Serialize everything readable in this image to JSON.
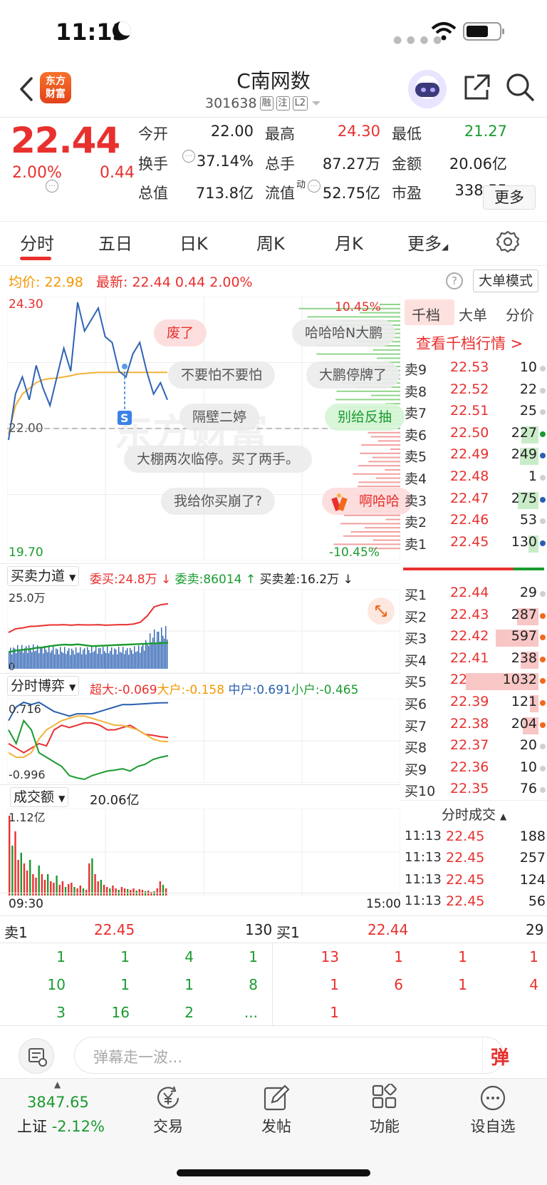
{
  "status": {
    "time": "11:13"
  },
  "header": {
    "logo_line1": "东方",
    "logo_line2": "财富",
    "name": "C南网数",
    "code": "301638",
    "tags": [
      "融",
      "注",
      "L2"
    ]
  },
  "quote": {
    "price": "22.44",
    "pct": "2.00%",
    "change": "0.44",
    "fields": [
      {
        "label": "今开",
        "value": "22.00",
        "color": "#222"
      },
      {
        "label": "最高",
        "value": "24.30",
        "color": "#e8302e"
      },
      {
        "label": "最低",
        "value": "21.27",
        "color": "#1a9b30"
      },
      {
        "label": "换手",
        "value": "37.14%",
        "color": "#222"
      },
      {
        "label": "总手",
        "value": "87.27万",
        "color": "#222"
      },
      {
        "label": "金额",
        "value": "20.06亿",
        "color": "#222"
      },
      {
        "label": "总值",
        "value": "713.8亿",
        "color": "#222"
      },
      {
        "label": "流值",
        "value": "52.75亿",
        "color": "#222"
      },
      {
        "label": "市盈",
        "value": "338.55",
        "color": "#222"
      }
    ],
    "pe_sup": "动",
    "more": "更多"
  },
  "tabs": [
    {
      "label": "分时",
      "active": true
    },
    {
      "label": "五日"
    },
    {
      "label": "日K"
    },
    {
      "label": "周K"
    },
    {
      "label": "月K"
    },
    {
      "label": "更多"
    }
  ],
  "avg_line": {
    "avg_label": "均价:",
    "avg_value": "22.98",
    "latest_label": "最新:",
    "latest_value": "22.44",
    "latest_chg": "0.44",
    "latest_pct": "2.00%",
    "mode_button": "大单模式"
  },
  "main_chart": {
    "y_top": "24.30",
    "y_mid": "22.00",
    "y_bottom": "19.70",
    "pct_top": "10.45%",
    "pct_bottom": "-10.45%",
    "marker": "S",
    "watermark": "东方财富"
  },
  "danmu": [
    "废了",
    "哈哈哈N大鹏",
    "不要怕不要怕",
    "大鹏停牌了",
    "隔壁二婷",
    "别给反抽",
    "大棚两次临停。买了两手。",
    "我给你买崩了?",
    "啊哈哈"
  ],
  "chart_data": [
    {
      "type": "line",
      "title": "",
      "series": [
        {
          "name": "",
          "values": [
            21.8,
            22.6,
            22.9,
            22.5,
            23.1,
            22.7,
            22.4,
            22.9,
            23.4,
            23.0,
            24.2,
            23.7,
            23.9,
            24.1,
            23.6,
            23.5,
            23.0,
            22.9,
            23.3,
            23.5,
            23.0,
            22.6,
            22.8,
            22.5
          ]
        },
        {
          "name": "",
          "values": [
            21.9,
            22.4,
            22.6,
            22.7,
            22.8,
            22.85,
            22.87,
            22.88,
            22.9,
            22.92,
            22.95,
            22.96,
            22.97,
            22.98,
            22.98,
            22.98,
            22.98,
            22.98,
            22.98,
            22.98,
            22.98,
            22.98,
            22.98,
            22.98
          ]
        }
      ],
      "ylim": [
        19.7,
        24.3
      ]
    },
    {
      "type": "line",
      "title": "",
      "series": [
        {
          "name": "委买",
          "values": [
            12.0,
            13.2,
            13.5,
            14.0,
            14.1,
            14.3,
            14.5,
            14.5,
            14.6,
            14.4,
            14.6,
            14.5,
            14.5,
            14.6,
            14.4,
            14.5,
            14.6,
            14.6,
            14.8,
            15.4,
            17.5,
            20.5,
            21.2,
            21.5
          ]
        },
        {
          "name": "委卖",
          "values": [
            5.5,
            6.0,
            6.3,
            6.5,
            6.9,
            7.1,
            7.5,
            7.8,
            8.0,
            7.9,
            8.1,
            7.8,
            7.5,
            7.6,
            7.7,
            7.8,
            7.9,
            8.0,
            8.1,
            8.2,
            8.3,
            8.4,
            8.5,
            8.6
          ]
        }
      ],
      "ylim": [
        0,
        25.0
      ]
    },
    {
      "type": "line",
      "title": "",
      "series": [
        {
          "name": "超大",
          "values": [
            -0.2,
            -0.3,
            -0.4,
            -0.3,
            -0.2,
            -0.25,
            0.1,
            0.2,
            0.15,
            0.2,
            0.25,
            0.25,
            0.2,
            0.1,
            0.1,
            0.15,
            0.2,
            0.1,
            0.0,
            -0.02,
            -0.05,
            -0.069
          ]
        },
        {
          "name": "大户",
          "values": [
            -0.4,
            -0.5,
            -0.5,
            -0.4,
            -0.1,
            0.1,
            0.2,
            0.3,
            0.35,
            0.4,
            0.4,
            0.35,
            0.3,
            0.25,
            0.2,
            0.2,
            0.15,
            0.1,
            0.0,
            -0.1,
            -0.15,
            -0.158
          ]
        },
        {
          "name": "中户",
          "values": [
            0.3,
            0.6,
            0.7,
            0.65,
            0.7,
            0.6,
            0.5,
            0.45,
            0.4,
            0.45,
            0.45,
            0.45,
            0.5,
            0.55,
            0.6,
            0.65,
            0.65,
            0.66,
            0.67,
            0.68,
            0.69,
            0.691
          ]
        },
        {
          "name": "小户",
          "values": [
            0.1,
            -0.2,
            0.3,
            0.1,
            -0.4,
            -0.5,
            -0.6,
            -0.7,
            -0.9,
            -0.95,
            -0.98,
            -0.9,
            -0.85,
            -0.8,
            -0.78,
            -0.75,
            -0.8,
            -0.7,
            -0.65,
            -0.55,
            -0.5,
            -0.465
          ]
        }
      ],
      "ylim": [
        -0.996,
        0.716
      ]
    },
    {
      "type": "bar",
      "title": "",
      "values": [
        1.12,
        0.7,
        0.9,
        0.5,
        0.6,
        0.45,
        0.35,
        0.5,
        0.3,
        0.25,
        0.42,
        0.3,
        0.22,
        0.3,
        0.2,
        0.18,
        0.28,
        0.15,
        0.2,
        0.12,
        0.16,
        0.18,
        0.12,
        0.1,
        0.14,
        0.1,
        0.08,
        0.45,
        0.52,
        0.3,
        0.2,
        0.22,
        0.15,
        0.12,
        0.1,
        0.14,
        0.1,
        0.08,
        0.12,
        0.1,
        0.09,
        0.08,
        0.1,
        0.07,
        0.09,
        0.08,
        0.06,
        0.07,
        0.05,
        0.06,
        0.1,
        0.2,
        0.15,
        0.1
      ],
      "ylim": [
        0,
        1.12
      ]
    }
  ],
  "order_book": {
    "tabs": [
      "千档",
      "大单",
      "分价"
    ],
    "view_all": "查看千档行情 >",
    "sells": [
      {
        "label": "卖9",
        "price": "22.53",
        "vol": "10",
        "bar": 0,
        "dot": "#d0d0d0"
      },
      {
        "label": "卖8",
        "price": "22.52",
        "vol": "22",
        "bar": 0,
        "dot": "#d0d0d0"
      },
      {
        "label": "卖7",
        "price": "22.51",
        "vol": "25",
        "bar": 0,
        "dot": "#d0d0d0"
      },
      {
        "label": "卖6",
        "price": "22.50",
        "vol": "227",
        "bar": 0.2,
        "dot": "#1a9b30"
      },
      {
        "label": "卖5",
        "price": "22.49",
        "vol": "249",
        "bar": 0.22,
        "dot": "#2a5fb0"
      },
      {
        "label": "卖4",
        "price": "22.48",
        "vol": "1",
        "bar": 0,
        "dot": "#d0d0d0"
      },
      {
        "label": "卖3",
        "price": "22.47",
        "vol": "275",
        "bar": 0.24,
        "dot": "#2a5fb0"
      },
      {
        "label": "卖2",
        "price": "22.46",
        "vol": "53",
        "bar": 0,
        "dot": "#d0d0d0"
      },
      {
        "label": "卖1",
        "price": "22.45",
        "vol": "130",
        "bar": 0.12,
        "dot": "#2a5fb0"
      }
    ],
    "buys": [
      {
        "label": "买1",
        "price": "22.44",
        "vol": "29",
        "bar": 0,
        "dot": "#d0d0d0"
      },
      {
        "label": "买2",
        "price": "22.43",
        "vol": "287",
        "bar": 0.25,
        "dot": "#f06a1d"
      },
      {
        "label": "买3",
        "price": "22.42",
        "vol": "597",
        "bar": 0.5,
        "dot": "#f06a1d"
      },
      {
        "label": "买4",
        "price": "22.41",
        "vol": "238",
        "bar": 0.21,
        "dot": "#f06a1d"
      },
      {
        "label": "买5",
        "price": "22.40",
        "vol": "1032",
        "bar": 0.85,
        "dot": "#f06a1d"
      },
      {
        "label": "买6",
        "price": "22.39",
        "vol": "121",
        "bar": 0.1,
        "dot": "#f06a1d"
      },
      {
        "label": "买7",
        "price": "22.38",
        "vol": "204",
        "bar": 0.18,
        "dot": "#f06a1d"
      },
      {
        "label": "买8",
        "price": "22.37",
        "vol": "20",
        "bar": 0,
        "dot": "#d0d0d0"
      },
      {
        "label": "买9",
        "price": "22.36",
        "vol": "10",
        "bar": 0,
        "dot": "#d0d0d0"
      },
      {
        "label": "买10",
        "price": "22.35",
        "vol": "76",
        "bar": 0,
        "dot": "#d0d0d0"
      }
    ],
    "ticks_title": "分时成交",
    "ticks": [
      {
        "time": "11:13",
        "price": "22.45",
        "vol": "188"
      },
      {
        "time": "11:13",
        "price": "22.45",
        "vol": "257"
      },
      {
        "time": "11:13",
        "price": "22.45",
        "vol": "124"
      },
      {
        "time": "11:13",
        "price": "22.45",
        "vol": "56"
      }
    ]
  },
  "panels": {
    "force": {
      "label": "买卖力道",
      "buy": "委买:24.8万 ↓",
      "sell": "委卖:86014 ↑",
      "diff": "买卖差:16.2万 ↓",
      "top": "25.0万",
      "bottom": "0"
    },
    "game": {
      "label": "分时博弈",
      "super": "超大:-0.069",
      "big": "大户:-0.158",
      "mid": "中户:0.691",
      "small": "小户:-0.465",
      "top": "0.716",
      "bottom": "-0.996"
    },
    "volume": {
      "label": "成交额",
      "value": "20.06亿",
      "top": "1.12亿",
      "t_start": "09:30",
      "t_end": "15:00"
    }
  },
  "bottom_book": {
    "sell_label": "卖1",
    "sell_price": "22.45",
    "sell_vol": "130",
    "buy_label": "买1",
    "buy_price": "22.44",
    "buy_vol": "29",
    "sell_grid": [
      [
        "1",
        "1",
        "4",
        "1"
      ],
      [
        "10",
        "1",
        "1",
        "8"
      ],
      [
        "3",
        "16",
        "2",
        "..."
      ]
    ],
    "buy_grid": [
      [
        "13",
        "1",
        "1",
        "1"
      ],
      [
        "1",
        "6",
        "1",
        "4"
      ],
      [
        "1",
        "",
        "",
        ""
      ]
    ]
  },
  "danmu_input": {
    "placeholder": "弹幕走一波...",
    "btn": "弹"
  },
  "nav": {
    "index_value": "3847.65",
    "index_name": "上证",
    "index_pct": "-2.12%",
    "items": [
      "交易",
      "发帖",
      "功能",
      "设自选"
    ]
  }
}
